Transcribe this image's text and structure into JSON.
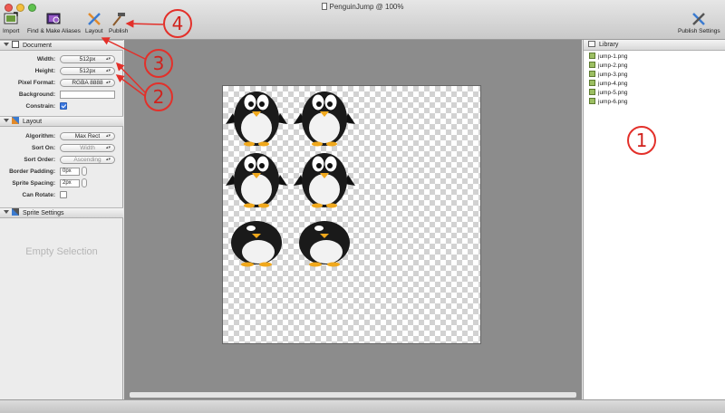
{
  "window": {
    "title": "PenguinJump @ 100%"
  },
  "toolbar": {
    "import_label": "Import",
    "find_aliases_label": "Find & Make Aliases",
    "layout_label": "Layout",
    "publish_label": "Publish",
    "publish_settings_label": "Publish Settings"
  },
  "document": {
    "header": "Document",
    "width_label": "Width:",
    "width_value": "512px",
    "height_label": "Height:",
    "height_value": "512px",
    "pixel_format_label": "Pixel Format:",
    "pixel_format_value": "RGBA 8888",
    "background_label": "Background:",
    "constrain_label": "Constrain:",
    "constrain_checked": true
  },
  "layout": {
    "header": "Layout",
    "algorithm_label": "Algorithm:",
    "algorithm_value": "Max Rect",
    "sort_on_label": "Sort On:",
    "sort_on_value": "Width",
    "sort_order_label": "Sort Order:",
    "sort_order_value": "Ascending",
    "border_padding_label": "Border Padding:",
    "border_padding_value": "0px",
    "sprite_spacing_label": "Sprite Spacing:",
    "sprite_spacing_value": "2px",
    "can_rotate_label": "Can Rotate:",
    "can_rotate_checked": false
  },
  "sprite_settings": {
    "header": "Sprite Settings",
    "empty_label": "Empty Selection"
  },
  "library": {
    "header": "Library",
    "items": [
      "jump-1.png",
      "jump-2.png",
      "jump-3.png",
      "jump-4.png",
      "jump-5.png",
      "jump-6.png"
    ]
  },
  "callouts": [
    "1",
    "2",
    "3",
    "4"
  ],
  "colors": {
    "callout": "#e3302a",
    "canvas_bg": "#8c8c8c",
    "checkbox_on": "#3b78e0"
  }
}
